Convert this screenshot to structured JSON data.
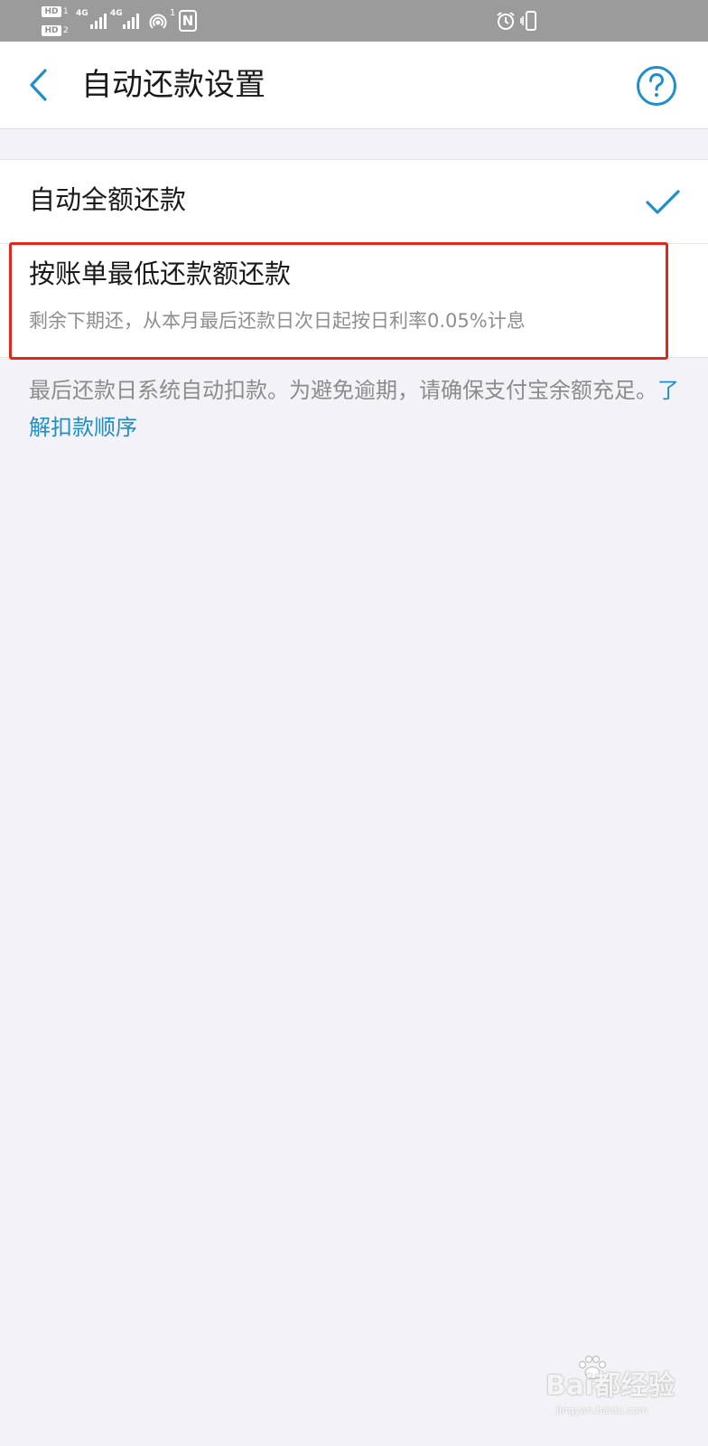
{
  "status_bar": {
    "hd_label_1": "HD",
    "hd_label_2": "HD",
    "sim1_network": "4G",
    "sim2_network": "4G",
    "hotspot_count": "1",
    "nfc_letter": "N"
  },
  "header": {
    "title": "自动还款设置"
  },
  "options": {
    "full": {
      "label": "自动全额还款",
      "selected": true
    },
    "minimum": {
      "label": "按账单最低还款额还款",
      "description": "剩余下期还，从本月最后还款日次日起按日利率0.05%计息",
      "selected": false
    }
  },
  "note": {
    "text": "最后还款日系统自动扣款。为避免逾期，请确保支付宝余额充足。",
    "link": "了解扣款顺序"
  },
  "watermark": {
    "text": "Bai都经验",
    "url": "jingyan.baidu.com"
  },
  "colors": {
    "accent": "#1e8fc8",
    "highlight": "#e1261c",
    "background": "#f2f2f7"
  }
}
